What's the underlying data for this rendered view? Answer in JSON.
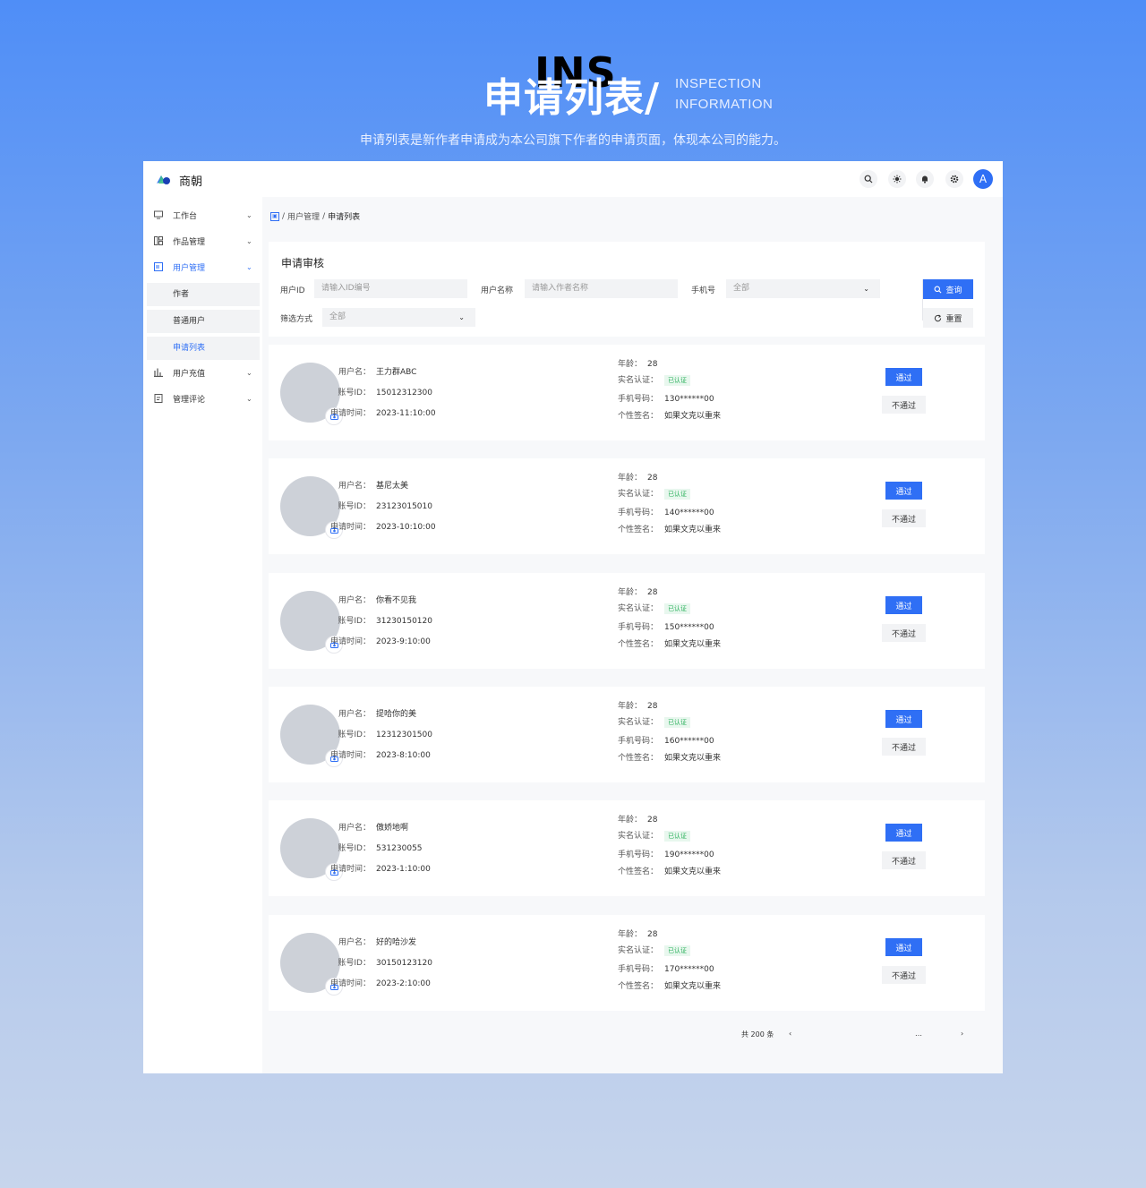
{
  "hero": {
    "ins": "INS",
    "title": "申请列表/",
    "en_line1": "INSPECTION",
    "en_line2": "INFORMATION",
    "desc": "申请列表是新作者申请成为本公司旗下作者的申请页面，体现本公司的能力。"
  },
  "app": {
    "brand": "商朝",
    "top_icons": [
      "search-icon",
      "sun-icon",
      "bell-icon",
      "gear-icon"
    ],
    "avatar_letter": "A",
    "accent": "#2f6ff5"
  },
  "sidebar": {
    "items": [
      {
        "label": "工作台",
        "icon": "monitor-icon"
      },
      {
        "label": "作品管理",
        "icon": "grid-icon"
      },
      {
        "label": "用户管理",
        "icon": "user-manage-icon"
      },
      {
        "label": "用户充值",
        "icon": "bar-chart-icon"
      },
      {
        "label": "管理评论",
        "icon": "document-icon"
      }
    ],
    "sub_items": [
      "作者",
      "普通用户",
      "申请列表"
    ]
  },
  "breadcrumb": {
    "level1": "用户管理",
    "sep": "/",
    "current": "申请列表"
  },
  "filter": {
    "title": "申请审核",
    "id_label": "用户ID",
    "id_placeholder": "请输入ID编号",
    "name_label": "用户名称",
    "name_placeholder": "请输入作者名称",
    "phone_label": "手机号",
    "phone_value": "全部",
    "mode_label": "筛选方式",
    "mode_value": "全部",
    "query_label": "查询",
    "reset_label": "重置"
  },
  "card_labels": {
    "username": "用户名：",
    "account": "账号ID：",
    "time": "申请时间：",
    "age": "年龄：",
    "verify": "实名认证：",
    "phone": "手机号码：",
    "signature": "个性签名：",
    "pass": "通过",
    "fail": "不通过"
  },
  "cards": [
    {
      "username": "王力群ABC",
      "account": "15012312300",
      "time": "2023-11:10:00",
      "age": "28",
      "verify": "已认证",
      "phone": "130******00",
      "signature": "如果文克以重来"
    },
    {
      "username": "基尼太美",
      "account": "23123015010",
      "time": "2023-10:10:00",
      "age": "28",
      "verify": "已认证",
      "phone": "140******00",
      "signature": "如果文克以重来"
    },
    {
      "username": "你看不见我",
      "account": "31230150120",
      "time": "2023-9:10:00",
      "age": "28",
      "verify": "已认证",
      "phone": "150******00",
      "signature": "如果文克以重来"
    },
    {
      "username": "提哈你的美",
      "account": "12312301500",
      "time": "2023-8:10:00",
      "age": "28",
      "verify": "已认证",
      "phone": "160******00",
      "signature": "如果文克以重来"
    },
    {
      "username": "傲娇地啊",
      "account": "531230055",
      "time": "2023-1:10:00",
      "age": "28",
      "verify": "已认证",
      "phone": "190******00",
      "signature": "如果文克以重来"
    },
    {
      "username": "好的哈沙发",
      "account": "30150123120",
      "time": "2023-2:10:00",
      "age": "28",
      "verify": "已认证",
      "phone": "170******00",
      "signature": "如果文克以重来"
    }
  ],
  "pager": {
    "total": "共 200 条",
    "prev": "‹",
    "ellipsis": "…",
    "next": "›"
  }
}
